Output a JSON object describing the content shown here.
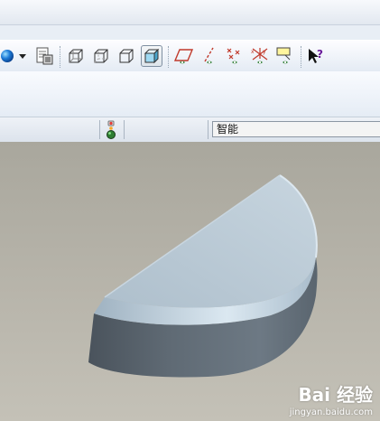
{
  "toolbar": {
    "buttons": [
      {
        "name": "appearance-ball-icon"
      },
      {
        "name": "dropdown-arrow-icon"
      },
      {
        "name": "model-tree-icon"
      },
      {
        "name": "wireframe-icon"
      },
      {
        "name": "hidden-line-icon"
      },
      {
        "name": "no-hidden-icon"
      },
      {
        "name": "shading-icon",
        "active": true
      },
      {
        "name": "datum-plane-icon"
      },
      {
        "name": "datum-axis-icon"
      },
      {
        "name": "datum-point-icon"
      },
      {
        "name": "coordinate-system-icon"
      },
      {
        "name": "annotation-display-icon"
      },
      {
        "name": "context-help-icon"
      }
    ]
  },
  "statusbar": {
    "indicator": "traffic-light-icon",
    "filter": {
      "value": "智能"
    }
  },
  "colors": {
    "viewport_top": "#a9a79d",
    "viewport_bottom": "#c4c1b7",
    "part_top": "#b8c9d6",
    "part_side": "#5f6b76"
  },
  "watermark": {
    "logo": "Bai 经验",
    "url": "jingyan.baidu.com"
  }
}
